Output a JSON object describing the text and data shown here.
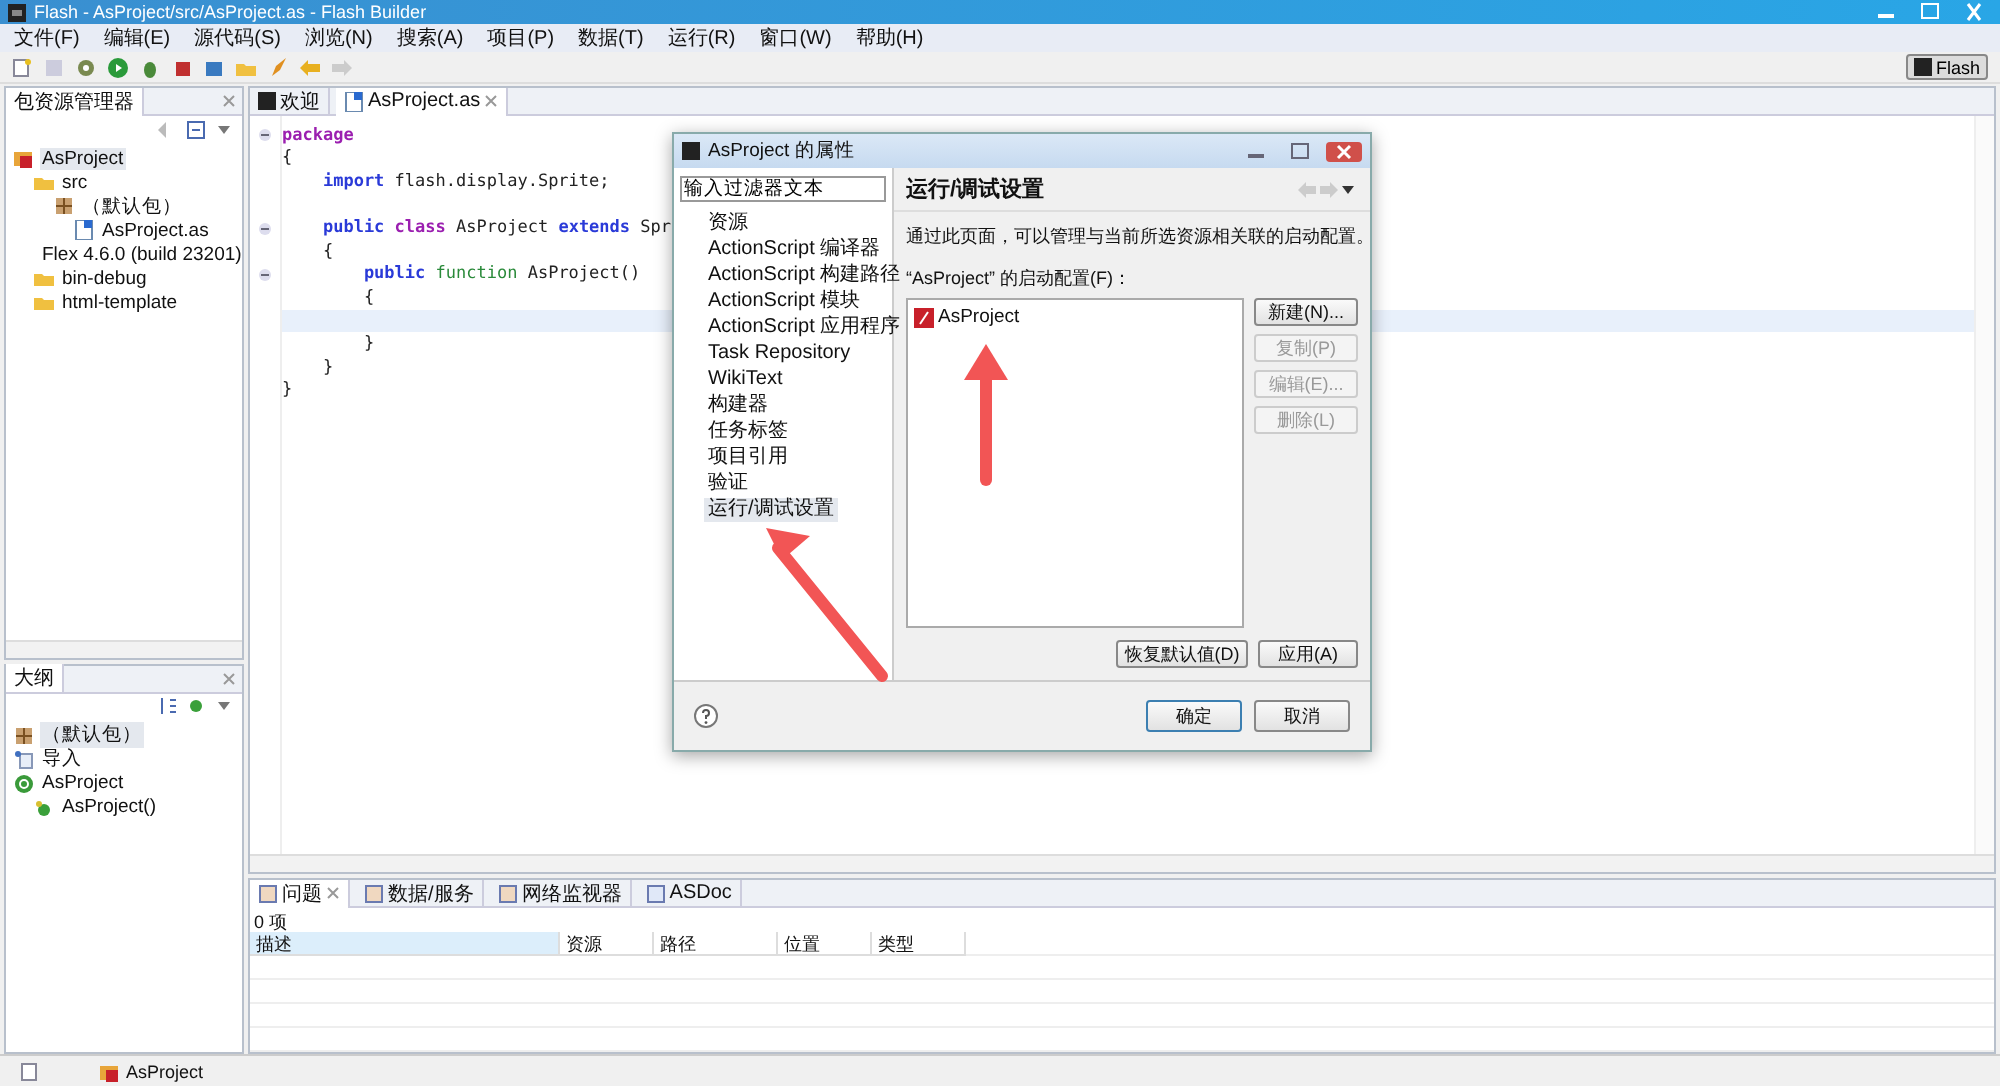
{
  "window": {
    "title": "Flash - AsProject/src/AsProject.as - Flash Builder"
  },
  "menu": [
    "文件(F)",
    "编辑(E)",
    "源代码(S)",
    "浏览(N)",
    "搜索(A)",
    "项目(P)",
    "数据(T)",
    "运行(R)",
    "窗口(W)",
    "帮助(H)"
  ],
  "perspective": {
    "label": "Flash",
    "selected": true
  },
  "package_explorer": {
    "title": "包资源管理器",
    "tree": [
      {
        "label": "AsProject",
        "kind": "project",
        "selected": true,
        "children": [
          {
            "label": "src",
            "kind": "folder",
            "selected": false,
            "children": [
              {
                "label": "（默认包）",
                "kind": "package",
                "selected": false,
                "children": [
                  {
                    "label": "AsProject.as",
                    "kind": "file",
                    "selected": false
                  }
                ]
              }
            ]
          },
          {
            "label": "Flex 4.6.0 (build 23201)",
            "kind": "library",
            "selected": false
          },
          {
            "label": "bin-debug",
            "kind": "folder",
            "selected": false
          },
          {
            "label": "html-template",
            "kind": "folder",
            "selected": false
          }
        ]
      }
    ]
  },
  "outline": {
    "title": "大纲",
    "tree": [
      {
        "label": "（默认包）",
        "kind": "package",
        "selected": true
      },
      {
        "label": "导入",
        "kind": "import",
        "selected": false
      },
      {
        "label": "AsProject",
        "kind": "class",
        "selected": false,
        "children": [
          {
            "label": "AsProject()",
            "kind": "method",
            "selected": false
          }
        ]
      }
    ]
  },
  "editor": {
    "tabs": [
      {
        "label": "欢迎",
        "selected": false
      },
      {
        "label": "AsProject.as",
        "selected": true
      }
    ],
    "lines": [
      {
        "fold": true,
        "current": false,
        "tokens": [
          {
            "text": "package",
            "kind": "keyword"
          }
        ]
      },
      {
        "fold": false,
        "current": false,
        "tokens": [
          {
            "text": "{",
            "kind": "plain"
          }
        ]
      },
      {
        "fold": false,
        "current": false,
        "tokens": [
          {
            "text": "    import",
            "kind": "modifier"
          },
          {
            "text": " flash.display.Sprite;",
            "kind": "plain"
          }
        ]
      },
      {
        "fold": false,
        "current": false
      },
      {
        "fold": true,
        "current": false,
        "tokens": [
          {
            "text": "    public",
            "kind": "modifier"
          },
          {
            "text": " class",
            "kind": "keyword"
          },
          {
            "text": " AsProject ",
            "kind": "plain"
          },
          {
            "text": "extends",
            "kind": "modifier"
          },
          {
            "text": " Spr",
            "kind": "plain"
          }
        ]
      },
      {
        "fold": false,
        "current": false,
        "tokens": [
          {
            "text": "    {",
            "kind": "plain"
          }
        ]
      },
      {
        "fold": true,
        "current": false,
        "tokens": [
          {
            "text": "        public",
            "kind": "modifier"
          },
          {
            "text": " function",
            "kind": "function"
          },
          {
            "text": " AsProject()",
            "kind": "plain"
          }
        ]
      },
      {
        "fold": false,
        "current": false,
        "tokens": [
          {
            "text": "        {",
            "kind": "plain"
          }
        ]
      },
      {
        "fold": false,
        "current": true
      },
      {
        "fold": false,
        "current": false,
        "tokens": [
          {
            "text": "        }",
            "kind": "plain"
          }
        ]
      },
      {
        "fold": false,
        "current": false,
        "tokens": [
          {
            "text": "    }",
            "kind": "plain"
          }
        ]
      },
      {
        "fold": false,
        "current": false,
        "tokens": [
          {
            "text": "}",
            "kind": "plain"
          }
        ]
      }
    ]
  },
  "dialog": {
    "title": "AsProject 的属性",
    "filter": "输入过滤器文本",
    "nav": [
      {
        "label": "资源",
        "selected": false
      },
      {
        "label": "ActionScript 编译器",
        "selected": false
      },
      {
        "label": "ActionScript 构建路径",
        "selected": false
      },
      {
        "label": "ActionScript 模块",
        "selected": false
      },
      {
        "label": "ActionScript 应用程序",
        "selected": false
      },
      {
        "label": "Task Repository",
        "selected": false
      },
      {
        "label": "WikiText",
        "selected": false
      },
      {
        "label": "构建器",
        "selected": false
      },
      {
        "label": "任务标签",
        "selected": false
      },
      {
        "label": "项目引用",
        "selected": false
      },
      {
        "label": "验证",
        "selected": false
      },
      {
        "label": "运行/调试设置",
        "selected": true
      }
    ],
    "page_title": "运行/调试设置",
    "description": "通过此页面，可以管理与当前所选资源相关联的启动配置。",
    "list_label": "“AsProject” 的启动配置(F)：",
    "configs": [
      {
        "label": "AsProject",
        "selected": false
      }
    ],
    "side_buttons": [
      {
        "label": "新建(N)...",
        "disabled": false
      },
      {
        "label": "复制(P)",
        "disabled": true
      },
      {
        "label": "编辑(E)...",
        "disabled": true
      },
      {
        "label": "删除(L)",
        "disabled": true
      }
    ],
    "restore_button": "恢复默认值(D)",
    "apply_button": "应用(A)",
    "ok_button": "确定",
    "cancel_button": "取消"
  },
  "problems": {
    "tabs": [
      {
        "label": "问题",
        "selected": true
      },
      {
        "label": "数据/服务",
        "selected": false
      },
      {
        "label": "网络监视器",
        "selected": false
      },
      {
        "label": "ASDoc",
        "selected": false
      }
    ],
    "count": "0 项",
    "columns": [
      "描述",
      "资源",
      "路径",
      "位置",
      "类型"
    ]
  },
  "status_bar": {
    "item": "AsProject"
  }
}
